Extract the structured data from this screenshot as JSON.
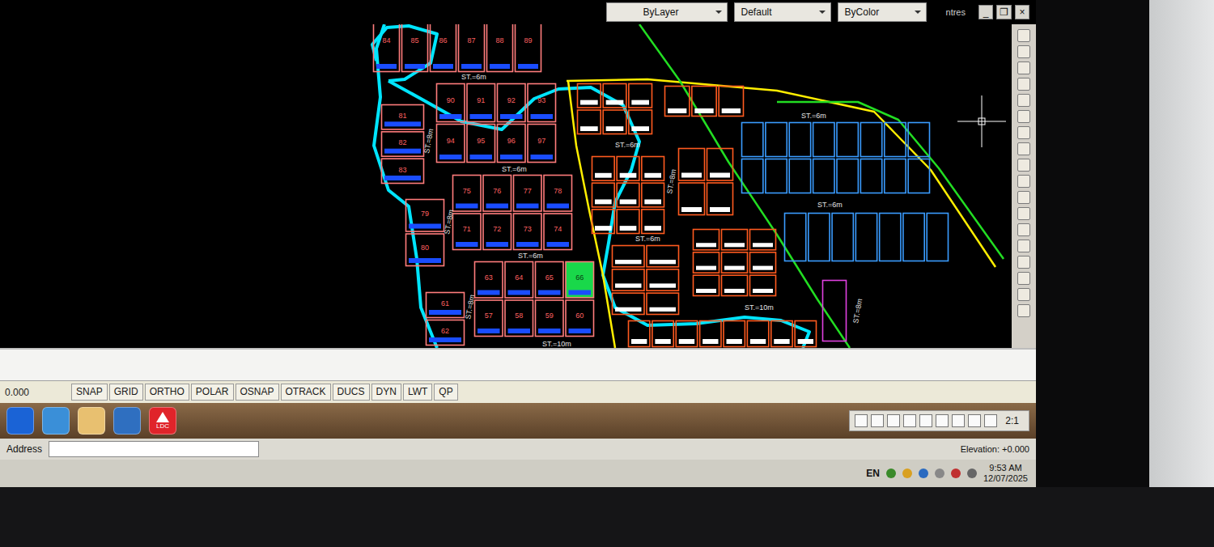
{
  "window": {
    "title_fragment": "ntres",
    "controls": [
      "_",
      "❐",
      "×"
    ]
  },
  "properties": [
    {
      "label": "ByLayer"
    },
    {
      "label": "Default"
    },
    {
      "label": "ByColor"
    }
  ],
  "drawing": {
    "blocks": [
      {
        "color": "#ff7c7c",
        "plots": [
          {
            "number": "84",
            "selected": false
          },
          {
            "number": "85",
            "selected": false
          },
          {
            "number": "86",
            "selected": false
          },
          {
            "number": "87",
            "selected": false
          },
          {
            "number": "88",
            "selected": false
          },
          {
            "number": "89",
            "selected": false
          }
        ]
      },
      {
        "color": "#ff7c7c",
        "plots": [
          {
            "number": "90",
            "selected": false
          },
          {
            "number": "91",
            "selected": false
          },
          {
            "number": "92",
            "selected": false
          },
          {
            "number": "93",
            "selected": false
          },
          {
            "number": "94",
            "selected": false
          },
          {
            "number": "95",
            "selected": false
          },
          {
            "number": "96",
            "selected": false
          },
          {
            "number": "97",
            "selected": false
          }
        ]
      },
      {
        "color": "#ff7c7c",
        "plots": [
          {
            "number": "81",
            "selected": false
          },
          {
            "number": "82",
            "selected": false
          },
          {
            "number": "83",
            "selected": false
          }
        ]
      },
      {
        "color": "#ff7c7c",
        "plots": [
          {
            "number": "75",
            "selected": false
          },
          {
            "number": "76",
            "selected": false
          },
          {
            "number": "77",
            "selected": false
          },
          {
            "number": "78",
            "selected": false
          },
          {
            "number": "71",
            "selected": false
          },
          {
            "number": "72",
            "selected": false
          },
          {
            "number": "73",
            "selected": false
          },
          {
            "number": "74",
            "selected": false
          }
        ]
      },
      {
        "color": "#ff7c7c",
        "plots": [
          {
            "number": "79",
            "selected": false
          },
          {
            "number": "80",
            "selected": false
          }
        ]
      },
      {
        "color": "#ff7c7c",
        "plots": [
          {
            "number": "63",
            "selected": false
          },
          {
            "number": "64",
            "selected": false
          },
          {
            "number": "65",
            "selected": false
          },
          {
            "number": "66",
            "selected": true
          },
          {
            "number": "57",
            "selected": false
          },
          {
            "number": "58",
            "selected": false
          },
          {
            "number": "59",
            "selected": false
          },
          {
            "number": "60",
            "selected": false
          }
        ]
      },
      {
        "color": "#ff7c7c",
        "plots": [
          {
            "number": "61",
            "selected": false
          },
          {
            "number": "62",
            "selected": false
          }
        ]
      },
      {
        "color": "#ff5a1f",
        "plots": [
          {
            "selected": false
          },
          {
            "selected": false
          },
          {
            "selected": false
          },
          {
            "selected": false
          },
          {
            "selected": false
          },
          {
            "selected": false
          }
        ]
      },
      {
        "color": "#ff5a1f",
        "plots": [
          {
            "selected": false
          },
          {
            "selected": false
          },
          {
            "selected": false
          }
        ]
      },
      {
        "color": "#ff5a1f",
        "plots": [
          {
            "selected": false
          },
          {
            "selected": false
          },
          {
            "selected": false
          },
          {
            "selected": false
          },
          {
            "selected": false
          },
          {
            "selected": false
          },
          {
            "selected": false
          },
          {
            "selected": false
          },
          {
            "selected": false
          }
        ]
      },
      {
        "color": "#ff5a1f",
        "plots": [
          {
            "selected": false
          },
          {
            "selected": false
          },
          {
            "selected": false
          },
          {
            "selected": false
          }
        ]
      },
      {
        "color": "#ff5a1f",
        "plots": [
          {
            "selected": false
          },
          {
            "selected": false
          },
          {
            "selected": false
          },
          {
            "selected": false
          },
          {
            "selected": false
          },
          {
            "selected": false
          }
        ]
      },
      {
        "color": "#ff5a1f",
        "plots": [
          {
            "selected": false
          },
          {
            "selected": false
          },
          {
            "selected": false
          },
          {
            "selected": false
          },
          {
            "selected": false
          },
          {
            "selected": false
          },
          {
            "selected": false
          },
          {
            "selected": false
          },
          {
            "selected": false
          }
        ]
      },
      {
        "color": "#ff5a1f",
        "plots": [
          {
            "selected": false
          },
          {
            "selected": false
          },
          {
            "selected": false
          },
          {
            "selected": false
          },
          {
            "selected": false
          },
          {
            "selected": false
          },
          {
            "selected": false
          },
          {
            "selected": false
          }
        ]
      },
      {
        "color": "#3a9cff",
        "plots": [
          {
            "selected": false
          },
          {
            "selected": false
          },
          {
            "selected": false
          },
          {
            "selected": false
          },
          {
            "selected": false
          },
          {
            "selected": false
          },
          {
            "selected": false
          },
          {
            "selected": false
          },
          {
            "selected": false
          },
          {
            "selected": false
          },
          {
            "selected": false
          },
          {
            "selected": false
          },
          {
            "selected": false
          },
          {
            "selected": false
          },
          {
            "selected": false
          },
          {
            "selected": false
          }
        ]
      },
      {
        "color": "#3a9cff",
        "plots": [
          {
            "selected": false
          },
          {
            "selected": false
          },
          {
            "selected": false
          },
          {
            "selected": false
          },
          {
            "selected": false
          },
          {
            "selected": false
          },
          {
            "selected": false
          }
        ]
      },
      {
        "color": "#e040e0",
        "plots": [
          {
            "selected": false
          }
        ]
      }
    ],
    "streets": [
      {
        "label": "ST.=6m"
      },
      {
        "label": "ST.=8m"
      },
      {
        "label": "ST.=6m"
      },
      {
        "label": "ST.=8m"
      },
      {
        "label": "ST.=6m"
      },
      {
        "label": "ST.=8m"
      },
      {
        "label": "ST.=10m"
      },
      {
        "label": "ST.=6m"
      },
      {
        "label": "ST.=8m"
      },
      {
        "label": "ST.=6m"
      },
      {
        "label": "ST.=10m"
      },
      {
        "label": "ST.=6m"
      },
      {
        "label": "ST.=6m"
      },
      {
        "label": "ST.=8m"
      }
    ],
    "lines": [
      {
        "color": "#00e5ff"
      },
      {
        "color": "#00e5ff"
      },
      {
        "color": "#00e5ff"
      },
      {
        "color": "#ffee00"
      },
      {
        "color": "#ffee00"
      },
      {
        "color": "#22dd22"
      },
      {
        "color": "#22dd22"
      }
    ]
  },
  "command": {
    "coordinates": "0.000"
  },
  "status_buttons": [
    {
      "label": "SNAP"
    },
    {
      "label": "GRID"
    },
    {
      "label": "ORTHO"
    },
    {
      "label": "POLAR"
    },
    {
      "label": "OSNAP"
    },
    {
      "label": "OTRACK"
    },
    {
      "label": "DUCS"
    },
    {
      "label": "DYN"
    },
    {
      "label": "LWT"
    },
    {
      "label": "QP"
    }
  ],
  "taskbar": {
    "apps": [
      {
        "color": "#1a63d6"
      },
      {
        "color": "#3a8fd8"
      },
      {
        "color": "#e8c070"
      },
      {
        "color": "#2f6fc0"
      },
      {
        "color": "#e0242a",
        "caption": "LDC"
      }
    ],
    "scale": "2:1"
  },
  "address": {
    "label": "Address",
    "elevation": "Elevation: +0.000"
  },
  "tray": {
    "language": "EN",
    "time": "9:53 AM",
    "date": "12/07/2025"
  }
}
